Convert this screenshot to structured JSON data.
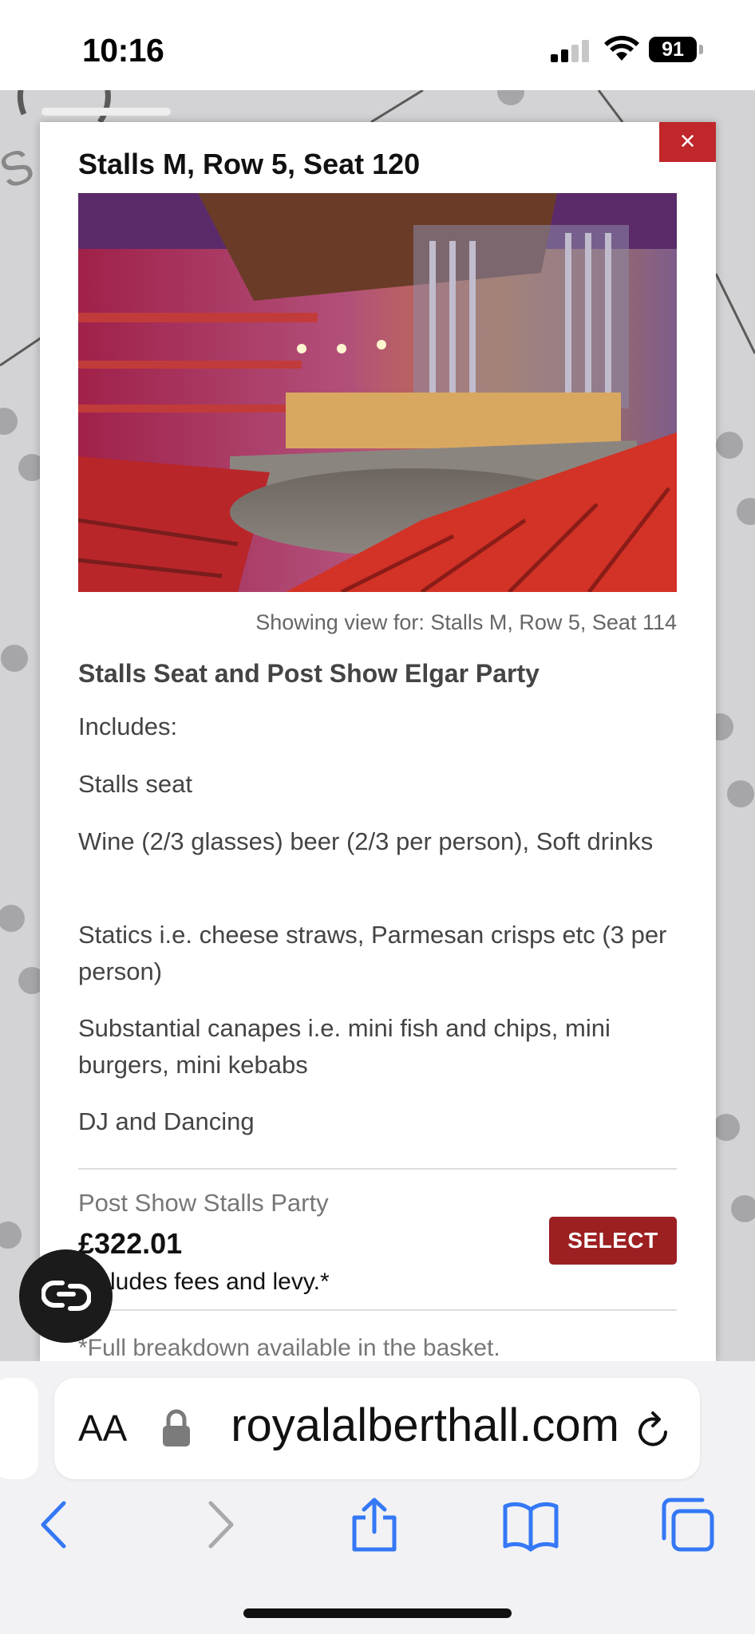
{
  "status_bar": {
    "time": "10:16",
    "battery": "91"
  },
  "modal": {
    "title": "Stalls M, Row 5, Seat 120",
    "close_label": "×",
    "view_caption": "Showing view for: Stalls M, Row 5, Seat 114",
    "package_title": "Stalls Seat and Post Show Elgar Party",
    "description": [
      "Includes:",
      "Stalls seat",
      "Wine (2/3 glasses) beer (2/3 per person), Soft drinks",
      "Statics i.e. cheese straws, Parmesan crisps etc (3 per person)",
      "Substantial canapes i.e. mini fish and chips, mini burgers, mini kebabs",
      "DJ and Dancing"
    ],
    "price_label": "Post Show Stalls Party",
    "price": "£322.01",
    "fees_note": "Includes fees and levy.*",
    "select_label": "SELECT",
    "breakdown_note": "*Full breakdown available in the basket."
  },
  "safari": {
    "aa_label": "AA",
    "url": "royalalberthall.com"
  },
  "colors": {
    "close_red": "#c0262a",
    "select_red": "#9c1f22",
    "ios_blue": "#3478f6"
  },
  "icons": [
    "signal-icon",
    "wifi-icon",
    "close-icon",
    "chat-icon",
    "lock-icon",
    "reload-icon",
    "back-icon",
    "forward-icon",
    "share-icon",
    "bookmarks-icon",
    "tabs-icon"
  ]
}
